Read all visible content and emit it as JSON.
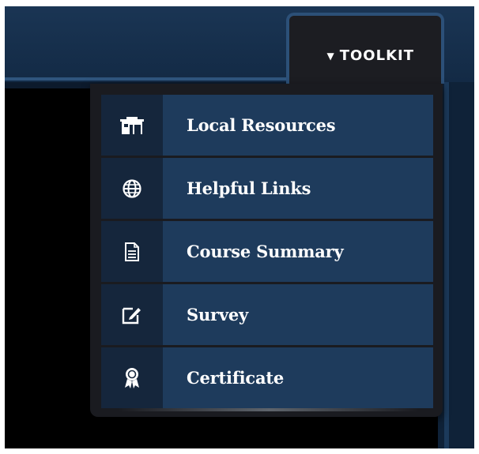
{
  "toolkit": {
    "label": "TOOLKIT",
    "arrow_icon": "triangle-down-icon"
  },
  "menu": {
    "items": [
      {
        "label": "Local Resources",
        "icon": "building-icon"
      },
      {
        "label": "Helpful Links",
        "icon": "globe-icon"
      },
      {
        "label": "Course Summary",
        "icon": "document-icon"
      },
      {
        "label": "Survey",
        "icon": "edit-pencil-icon"
      },
      {
        "label": "Certificate",
        "icon": "award-ribbon-icon"
      }
    ]
  },
  "colors": {
    "header": "#1a3554",
    "tab_bg": "#1c1d22",
    "tab_border": "#2c5078",
    "item_label_bg": "#1e3b5c",
    "item_icon_bg": "#15263c",
    "text": "#ffffff"
  }
}
